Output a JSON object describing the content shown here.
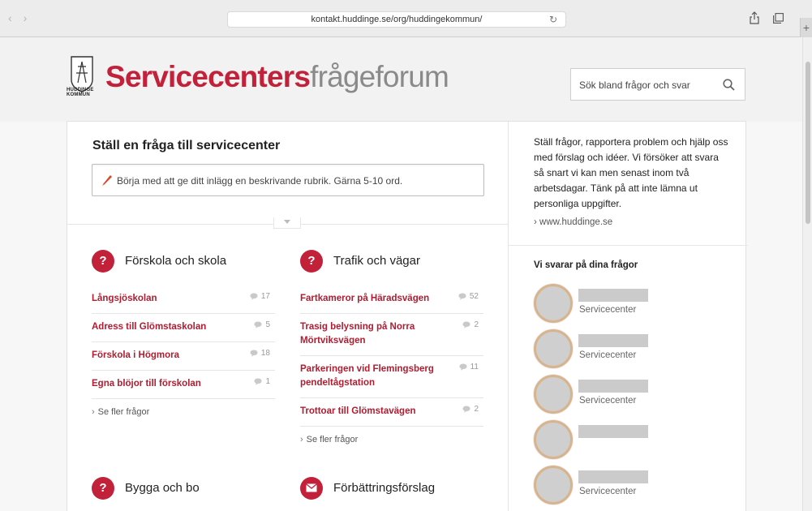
{
  "browser": {
    "url": "kontakt.huddinge.se/org/huddingekommun/",
    "back": "‹",
    "forward": "›",
    "reload": "↻",
    "new_tab": "+"
  },
  "header": {
    "logo_text_line1": "HUDDINGE",
    "logo_text_line2": "KOMMUN",
    "title_part1": "Servicecenters",
    "title_part2": "frågeforum",
    "search_placeholder": "Sök bland frågor och svar"
  },
  "ask": {
    "title": "Ställ en fråga till servicecenter",
    "placeholder": "Börja med att ge ditt inlägg en beskrivande rubrik. Gärna 5-10 ord."
  },
  "categories": [
    {
      "title": "Förskola och skola",
      "icon": "question-icon",
      "badge": "?",
      "questions": [
        {
          "title": "Långsjöskolan",
          "count": "17"
        },
        {
          "title": "Adress till Glömstaskolan",
          "count": "5"
        },
        {
          "title": "Förskola i Högmora",
          "count": "18"
        },
        {
          "title": "Egna blöjor till förskolan",
          "count": "1"
        }
      ],
      "more": "Se fler frågor"
    },
    {
      "title": "Trafik och vägar",
      "icon": "question-icon",
      "badge": "?",
      "questions": [
        {
          "title": "Fartkameror på Häradsvägen",
          "count": "52"
        },
        {
          "title": "Trasig belysning på Norra Mörtviksvägen",
          "count": "2"
        },
        {
          "title": "Parkeringen vid Flemingsberg pendeltågstation",
          "count": "11"
        },
        {
          "title": "Trottoar till Glömstavägen",
          "count": "2"
        }
      ],
      "more": "Se fler frågor"
    },
    {
      "title": "Bygga och bo",
      "icon": "question-icon",
      "badge": "?"
    },
    {
      "title": "Förbättringsförslag",
      "icon": "envelope-icon",
      "badge": ""
    }
  ],
  "sidebar": {
    "intro": "Ställ frågor, rapportera problem och hjälp oss med förslag och idéer. Vi försöker att svara så snart vi kan men senast inom två arbetsdagar. Tänk på att inte lämna ut personliga uppgifter.",
    "link": "www.huddinge.se",
    "answer_title": "Vi svarar på dina frågor",
    "people": [
      {
        "role": "Servicecenter"
      },
      {
        "role": "Servicecenter"
      },
      {
        "role": "Servicecenter"
      },
      {
        "role": ""
      },
      {
        "role": "Servicecenter"
      }
    ]
  },
  "colors": {
    "brand_red": "#c2213a",
    "link_red": "#b01c30",
    "title_gray": "#8a8a8a"
  }
}
